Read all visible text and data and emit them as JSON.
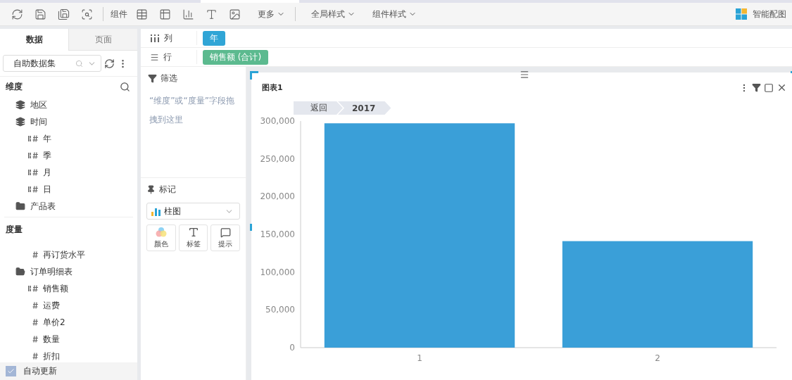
{
  "toolbar": {
    "items": [
      {
        "kind": "refresh"
      },
      {
        "kind": "save"
      },
      {
        "kind": "save-as"
      },
      {
        "kind": "preview"
      },
      {
        "kind": "divider"
      },
      {
        "kind": "label",
        "text": "组件"
      },
      {
        "kind": "table"
      },
      {
        "kind": "crosstab"
      },
      {
        "kind": "bar-chart"
      },
      {
        "kind": "text"
      },
      {
        "kind": "image"
      },
      {
        "kind": "menu",
        "text": "更多"
      },
      {
        "kind": "divider"
      },
      {
        "kind": "menu",
        "text": "全局样式"
      },
      {
        "kind": "menu",
        "text": "组件样式"
      }
    ],
    "smart": "智能配图"
  },
  "left_panel": {
    "tabs": [
      {
        "label": "数据",
        "selected": true
      },
      {
        "label": "页面",
        "selected": false
      }
    ],
    "dataset": "自助数据集",
    "dimensions": {
      "title": "维度",
      "items": [
        {
          "label": "地区",
          "kind": "layers"
        },
        {
          "label": "时间",
          "kind": "layers",
          "children": [
            {
              "label": "年",
              "kind": "date"
            },
            {
              "label": "季",
              "kind": "date"
            },
            {
              "label": "月",
              "kind": "date"
            },
            {
              "label": "日",
              "kind": "date"
            }
          ]
        },
        {
          "label": "产品表",
          "kind": "folder"
        }
      ]
    },
    "measures": {
      "title": "度量",
      "items": [
        {
          "children": [
            {
              "label": "再订货水平",
              "kind": "number"
            }
          ]
        },
        {
          "label": "订单明细表",
          "kind": "folder-open",
          "children": [
            {
              "label": "销售额",
              "kind": "date"
            },
            {
              "label": "运费",
              "kind": "number"
            },
            {
              "label": "单价2",
              "kind": "number"
            },
            {
              "label": "数量",
              "kind": "number"
            },
            {
              "label": "折扣",
              "kind": "number"
            }
          ]
        }
      ]
    },
    "auto_update": {
      "label": "自动更新",
      "checked": true
    }
  },
  "shelves": [
    {
      "label": "列",
      "kind": "columns",
      "pill": {
        "text": "年",
        "color": "#30a5d6"
      }
    },
    {
      "label": "行",
      "kind": "rows",
      "pill": {
        "text": "销售额 (合计)",
        "color": "#5cba8f"
      }
    }
  ],
  "filter": {
    "title": "筛选",
    "hint": "“维度”或“度量”字段拖拽到这里"
  },
  "marks": {
    "title": "标记",
    "chart_type": "柱图",
    "buttons": [
      {
        "label": "颜色",
        "kind": "color"
      },
      {
        "label": "标签",
        "kind": "label"
      },
      {
        "label": "提示",
        "kind": "tooltip"
      }
    ]
  },
  "chart": {
    "title": "图表1",
    "breadcrumb": [
      {
        "text": "返回",
        "bold": false
      },
      {
        "text": "2017",
        "bold": true
      }
    ],
    "chart_data": {
      "type": "bar",
      "categories": [
        "1",
        "2"
      ],
      "series": [
        {
          "color": "#3a9fd8",
          "values": [
            297000,
            141000
          ]
        }
      ],
      "ylim": [
        0,
        300000
      ],
      "yticks": [
        {
          "value": 0,
          "label": "0"
        },
        {
          "value": 50000,
          "label": "50,000"
        },
        {
          "value": 100000,
          "label": "100,000"
        },
        {
          "value": 150000,
          "label": "150,000"
        },
        {
          "value": 200000,
          "label": "200,000"
        },
        {
          "value": 250000,
          "label": "250,000"
        },
        {
          "value": 300000,
          "label": "300,000"
        }
      ]
    }
  }
}
